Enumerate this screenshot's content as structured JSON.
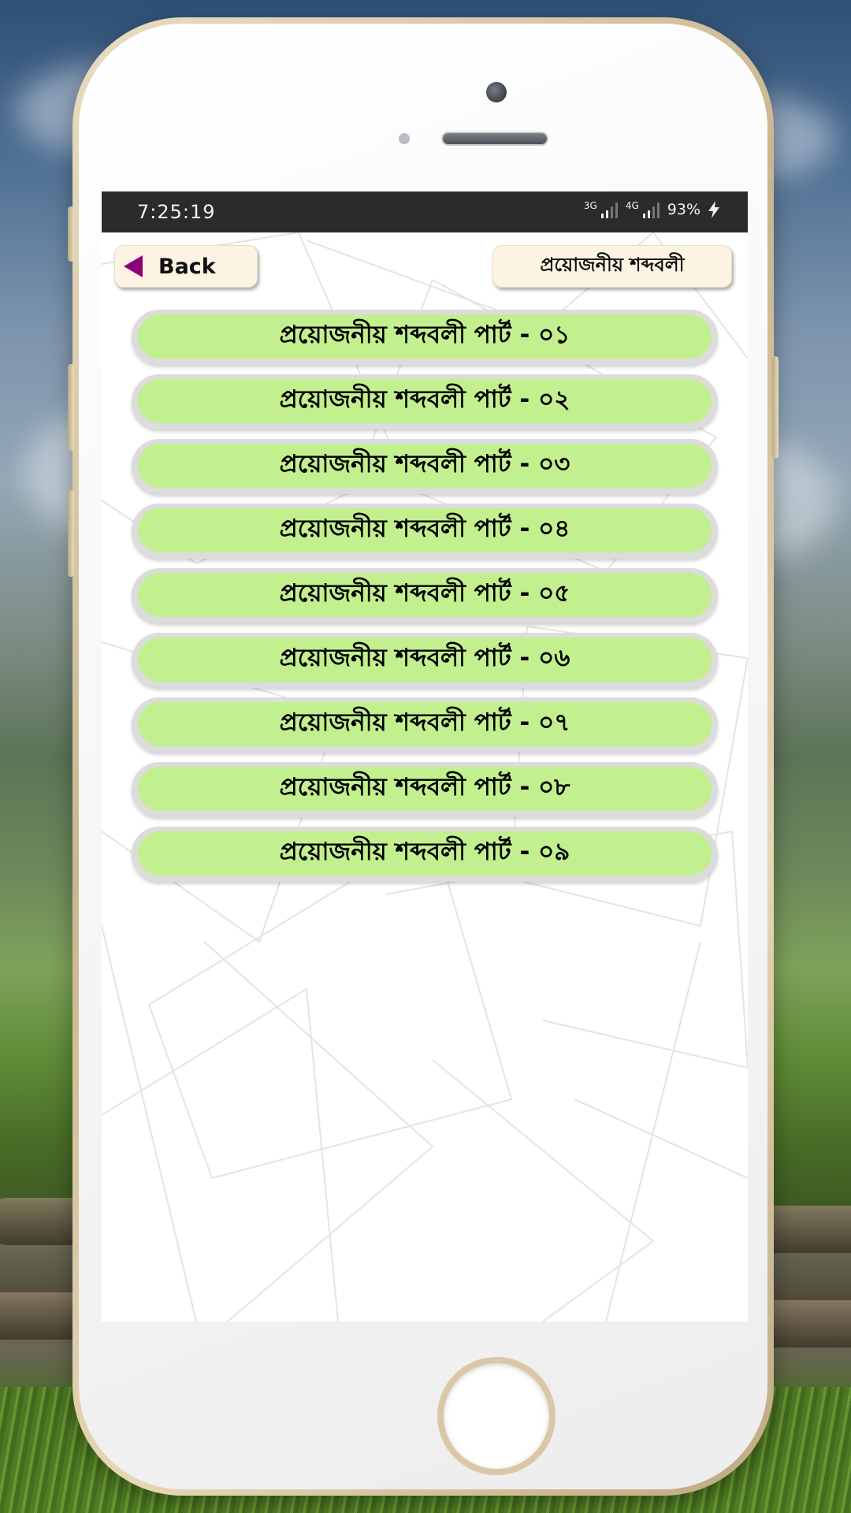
{
  "status_bar": {
    "time": "7:25:19",
    "network1": "3G",
    "network2": "4G",
    "battery": "93%"
  },
  "header": {
    "back_label": "Back",
    "title": "প্রয়োজনীয় শব্দবলী"
  },
  "list": {
    "items": [
      {
        "label": "প্রয়োজনীয় শব্দবলী পার্ট - ০১"
      },
      {
        "label": "প্রয়োজনীয় শব্দবলী পার্ট - ০২"
      },
      {
        "label": "প্রয়োজনীয় শব্দবলী পার্ট - ০৩"
      },
      {
        "label": "প্রয়োজনীয় শব্দবলী পার্ট - ০৪"
      },
      {
        "label": "প্রয়োজনীয় শব্দবলী পার্ট - ০৫"
      },
      {
        "label": "প্রয়োজনীয় শব্দবলী পার্ট - ০৬"
      },
      {
        "label": "প্রয়োজনীয় শব্দবলী পার্ট - ০৭"
      },
      {
        "label": "প্রয়োজনীয় শব্দবলী পার্ট - ০৮"
      },
      {
        "label": "প্রয়োজনীয় শব্দবলী পার্ট - ০৯"
      }
    ]
  },
  "colors": {
    "item_fill": "#c3f08f",
    "back_arrow": "#8c007a",
    "button_fill": "#fdf3e2",
    "statusbar": "#2b2b2b"
  },
  "icons": {
    "back": "back-arrow-icon",
    "battery": "charging-bolt-icon",
    "signal": "signal-bars-icon"
  }
}
